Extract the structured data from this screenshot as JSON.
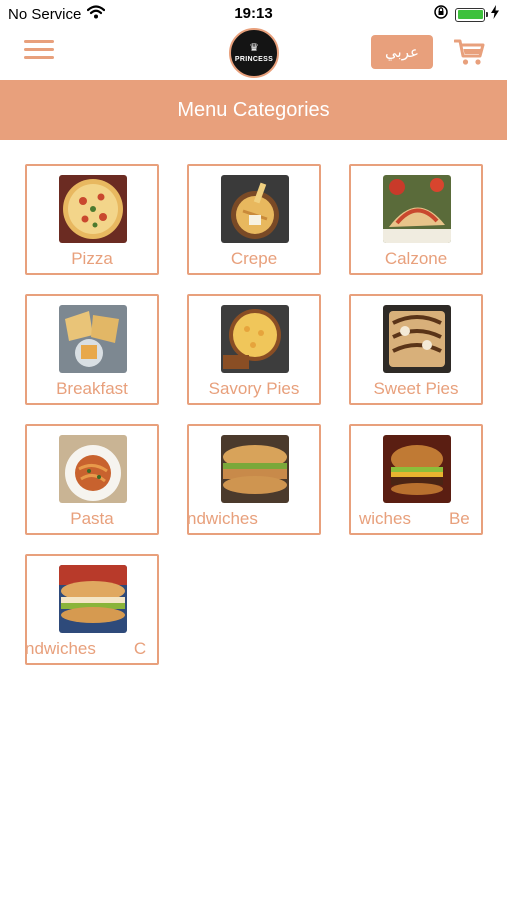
{
  "status": {
    "carrier": "No Service",
    "time": "19:13"
  },
  "header": {
    "logo_text": "PRINCESS",
    "lang_label": "عربي"
  },
  "banner": {
    "title": "Menu Categories"
  },
  "categories": [
    {
      "label": "Pizza"
    },
    {
      "label": "Crepe"
    },
    {
      "label": "Calzone"
    },
    {
      "label": "Breakfast"
    },
    {
      "label": "Savory Pies"
    },
    {
      "label": "Sweet Pies"
    },
    {
      "label": "Pasta"
    },
    {
      "label": "ndwiches"
    },
    {
      "label": "wiches",
      "label_next": "Be"
    },
    {
      "label": "ndwiches",
      "label_next": "C"
    }
  ],
  "colors": {
    "accent": "#e8a07c",
    "battery": "#3ec13c"
  }
}
